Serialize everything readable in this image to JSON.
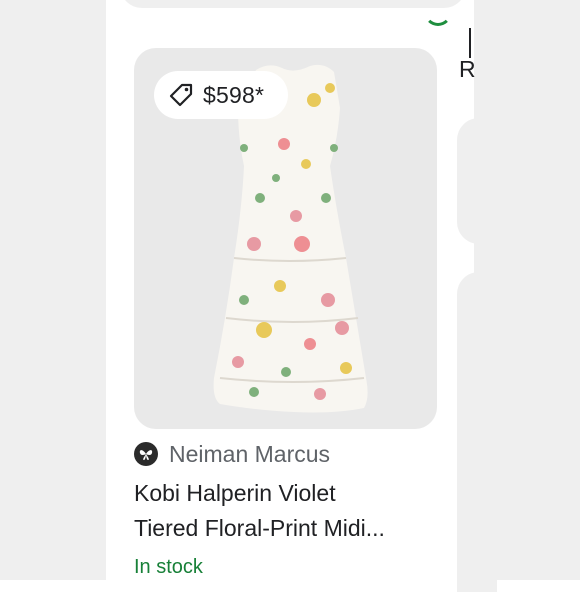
{
  "product": {
    "price": "$598*",
    "merchant": "Neiman Marcus",
    "title_line1": "Kobi Halperin Violet",
    "title_line2": "Tiered Floral-Print Midi...",
    "availability": "In stock"
  },
  "next_card": {
    "title_initial": "R"
  },
  "icons": {
    "price_tag": "tag-icon",
    "merchant_logo": "butterfly-icon",
    "prev_status": "check-circle-icon"
  },
  "colors": {
    "availability": "#188038",
    "card_bg": "#e9e9e9",
    "page_bg": "#efefef"
  }
}
